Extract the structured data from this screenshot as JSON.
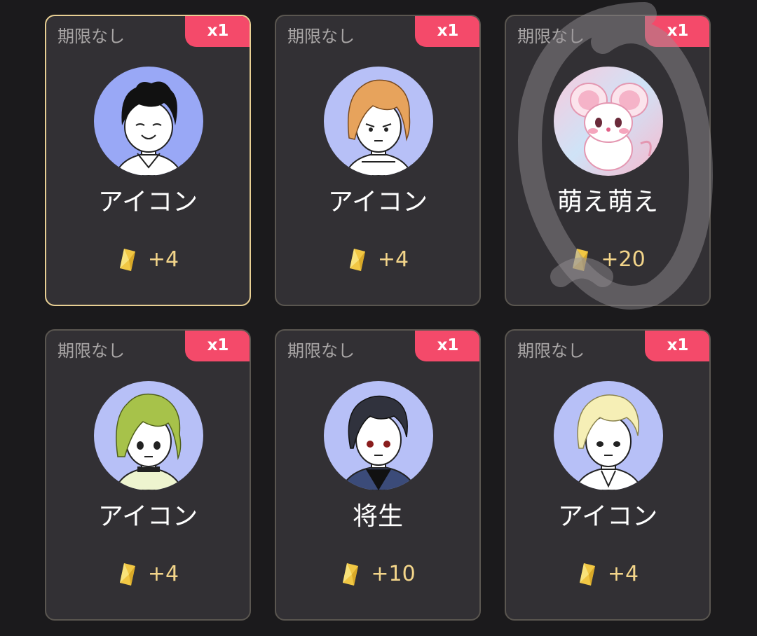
{
  "cards": [
    {
      "expiry": "期限なし",
      "qty": "x1",
      "name": "アイコン",
      "points": "+4"
    },
    {
      "expiry": "期限なし",
      "qty": "x1",
      "name": "アイコン",
      "points": "+4"
    },
    {
      "expiry": "期限なし",
      "qty": "x1",
      "name": "萌え萌え",
      "points": "+20"
    },
    {
      "expiry": "期限なし",
      "qty": "x1",
      "name": "アイコン",
      "points": "+4"
    },
    {
      "expiry": "期限なし",
      "qty": "x1",
      "name": "将生",
      "points": "+10"
    },
    {
      "expiry": "期限なし",
      "qty": "x1",
      "name": "アイコン",
      "points": "+4"
    }
  ],
  "colors": {
    "background": "#1b1a1c",
    "card": "#323034",
    "card_border": "#5a5650",
    "selected_border": "#e8cf93",
    "badge": "#f44a6a",
    "points": "#f3d58a"
  },
  "icons": {
    "reward": "gem-icon"
  }
}
